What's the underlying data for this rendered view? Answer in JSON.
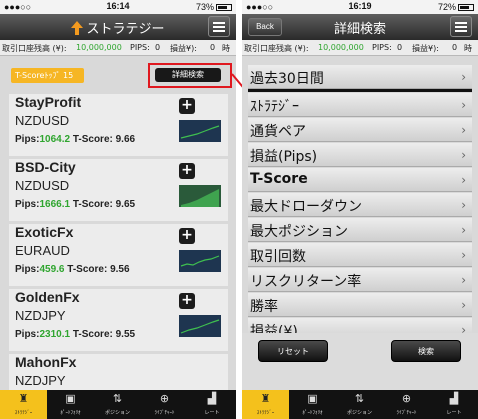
{
  "status_bar": {
    "left": {
      "signal": "●●●○○",
      "carrier": "",
      "wifi_icon": "wifi-icon"
    },
    "time_left": "16:14",
    "battery_left": "73%",
    "time_right": "16:19",
    "battery_right": "72%"
  },
  "left_screen": {
    "title": "ストラテジー",
    "ticker": {
      "balance_label": "取引口座残高 (¥):",
      "balance_value": "10,000,000",
      "pips_label": "PIPS:",
      "pips_value": "0",
      "pl_label": "損益¥):",
      "pl_value": "0",
      "extra": "時"
    },
    "ranking_badge": "T-Scoreﾄｯﾌﾟ 15",
    "detail_search_button": "詳細検索",
    "strategies": [
      {
        "name": "StayProfit",
        "pair": "NZDUSD",
        "pips_label": "Pips:",
        "pips": "1064.2",
        "tscore_label": "T-Score:",
        "tscore": "9.66"
      },
      {
        "name": "BSD-City",
        "pair": "NZDUSD",
        "pips_label": "Pips:",
        "pips": "1666.1",
        "tscore_label": "T-Score:",
        "tscore": "9.65"
      },
      {
        "name": "ExoticFx",
        "pair": "EURAUD",
        "pips_label": "Pips:",
        "pips": "459.6",
        "tscore_label": "T-Score:",
        "tscore": "9.56"
      },
      {
        "name": "GoldenFx",
        "pair": "NZDJPY",
        "pips_label": "Pips:",
        "pips": "2310.1",
        "tscore_label": "T-Score:",
        "tscore": "9.55"
      },
      {
        "name": "MahonFx",
        "pair": "NZDJPY",
        "pips_label": "",
        "pips": "",
        "tscore_label": "",
        "tscore": ""
      }
    ]
  },
  "right_screen": {
    "back_button": "Back",
    "title": "詳細検索",
    "ticker": {
      "balance_label": "取引口座残高 (¥):",
      "balance_value": "10,000,000",
      "pips_label": "PIPS:",
      "pips_value": "0",
      "pl_label": "損益¥):",
      "pl_value": "0",
      "extra": "時"
    },
    "rows": [
      "過去30日間",
      "ｽﾄﾗﾃｼﾞｰ",
      "通貨ペア",
      "損益(Pips)",
      "T-Score",
      "最大ドローダウン",
      "最大ポジション",
      "取引回数",
      "リスクリターン率",
      "勝率",
      "損益(¥)"
    ],
    "chevron": "›",
    "reset_button": "リセット",
    "search_button": "検索"
  },
  "tab_bar": [
    {
      "label": "ｽﾄﾗﾃｼﾞｰ",
      "icon": "tower-icon",
      "glyph": "♜"
    },
    {
      "label": "ﾎﾟｰﾄﾌｫﾘｵ",
      "icon": "briefcase-icon",
      "glyph": "▣"
    },
    {
      "label": "ポジション",
      "icon": "updown-arrows-icon",
      "glyph": "⇅"
    },
    {
      "label": "ﾗｲﾌﾞﾁｬｰﾄ",
      "icon": "crosshair-icon",
      "glyph": "⊕"
    },
    {
      "label": "レート",
      "icon": "chart-icon",
      "glyph": "▟"
    }
  ],
  "colors": {
    "accent": "#f6b624",
    "green": "#2fa52f",
    "highlight": "#e0181f"
  }
}
